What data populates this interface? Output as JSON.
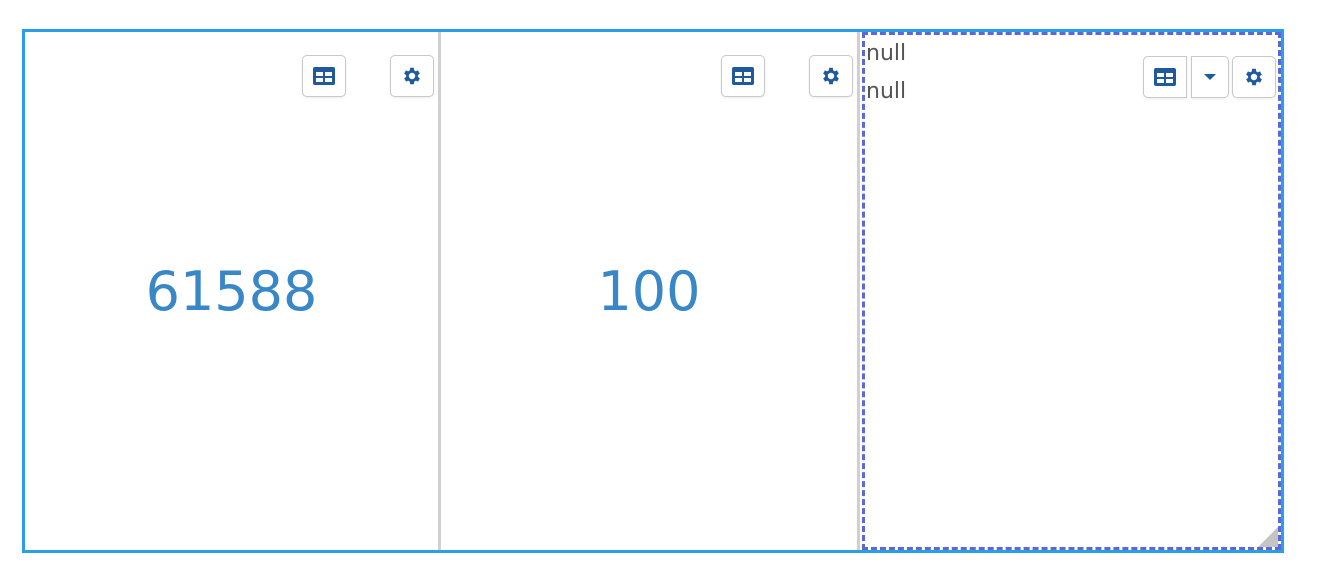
{
  "panels": [
    {
      "value": "61588"
    },
    {
      "value": "100"
    },
    {
      "lines": [
        "null",
        "null"
      ]
    }
  ],
  "icons": {
    "table": "table-icon",
    "settings": "gear-icon",
    "dropdown": "caret-down-icon"
  },
  "colors": {
    "accent": "#2b9ee9",
    "value": "#3a87c8",
    "icon": "#1f5a9e",
    "selected_border": "#5b69d6"
  }
}
